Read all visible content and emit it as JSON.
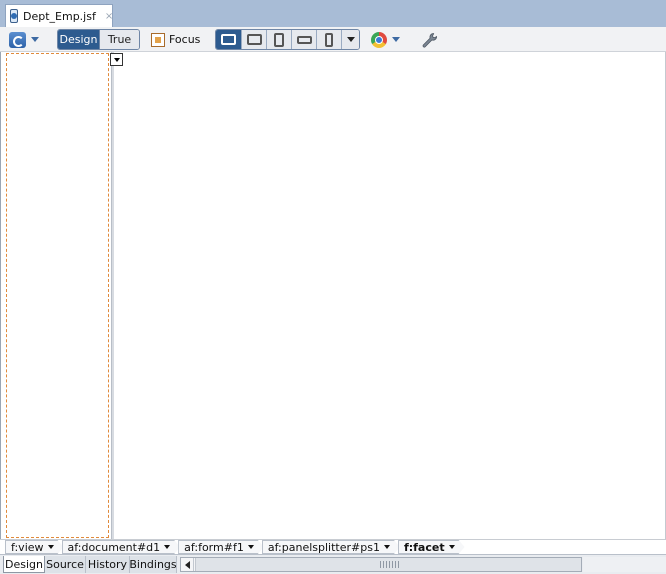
{
  "editor_tab": {
    "title": "Dept_Emp.jsf",
    "close_glyph": "×",
    "icon": "jsf-file-icon"
  },
  "toolbar": {
    "refresh_icon": "refresh-icon",
    "design_label": "Design",
    "true_label": "True",
    "focus_label": "Focus",
    "devices": [
      "desktop-icon",
      "tablet-landscape-icon",
      "tablet-portrait-icon",
      "phone-landscape-icon",
      "phone-portrait-icon"
    ],
    "browser_icon": "chrome-browser-icon",
    "settings_icon": "wrench-icon"
  },
  "breadcrumb": [
    {
      "label": "f:view"
    },
    {
      "label": "af:document#d1"
    },
    {
      "label": "af:form#f1"
    },
    {
      "label": "af:panelsplitter#ps1"
    },
    {
      "label": "f:facet"
    }
  ],
  "bottom_tabs": [
    {
      "label": "Design"
    },
    {
      "label": "Source"
    },
    {
      "label": "History"
    },
    {
      "label": "Bindings"
    }
  ],
  "colors": {
    "accent": "#2d5b8f",
    "tabstrip": "#a8bcd6",
    "dashed_border": "#e08a3c"
  }
}
